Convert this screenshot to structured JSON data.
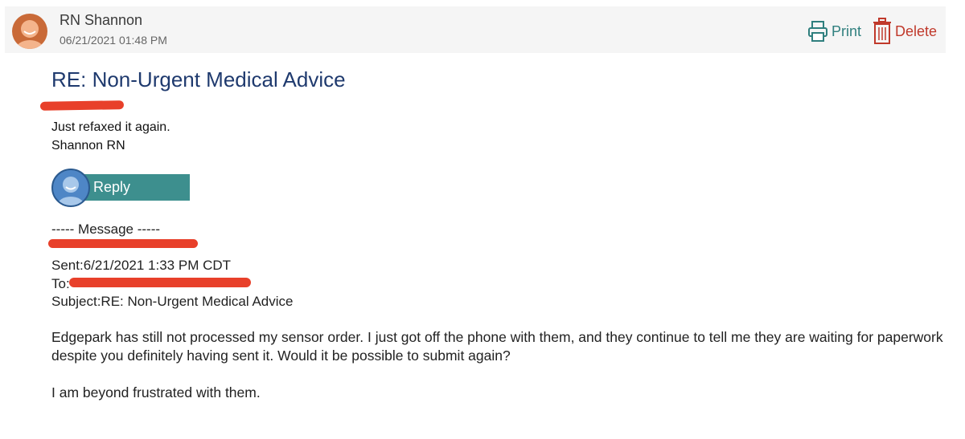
{
  "header": {
    "sender_name": "RN Shannon",
    "sender_date": "06/21/2021 01:48 PM",
    "print_label": "Print",
    "delete_label": "Delete"
  },
  "message": {
    "subject": "RE: Non-Urgent Medical Advice",
    "reply_lines": [
      "Just refaxed it again.",
      "Shannon RN"
    ],
    "reply_button": "Reply"
  },
  "original": {
    "separator": "----- Message -----",
    "sent": "Sent:6/21/2021 1:33 PM CDT",
    "to_prefix": "To:",
    "subject": "Subject:RE: Non-Urgent Medical Advice",
    "paragraph1": "Edgepark has still not processed my sensor order. I just got off the phone with them, and they continue to tell me they are waiting for paperwork despite you definitely having sent it. Would it be possible to submit again?",
    "paragraph2": "I am beyond frustrated with them."
  },
  "colors": {
    "accent": "#3d8f8e",
    "subject": "#1f3a6e",
    "delete": "#c0392b",
    "redaction": "#e8402a"
  }
}
